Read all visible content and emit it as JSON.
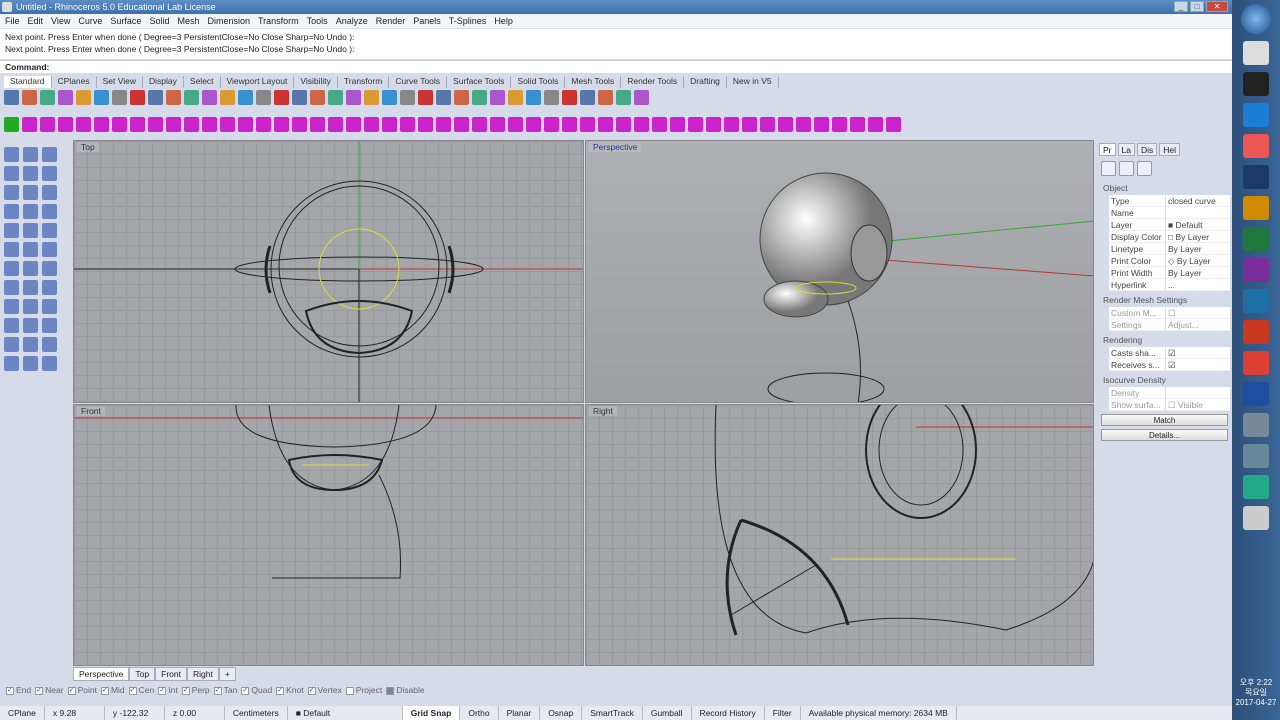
{
  "window": {
    "title": "Untitled - Rhinoceros 5.0 Educational Lab License"
  },
  "menu": [
    "File",
    "Edit",
    "View",
    "Curve",
    "Surface",
    "Solid",
    "Mesh",
    "Dimension",
    "Transform",
    "Tools",
    "Analyze",
    "Render",
    "Panels",
    "T-Splines",
    "Help"
  ],
  "command": {
    "history": [
      "Next point. Press Enter when done ( Degree=3  PersistentClose=No  Close  Sharp=No  Undo ):",
      "Next point. Press Enter when done ( Degree=3  PersistentClose=No  Close  Sharp=No  Undo ):"
    ],
    "prompt": "Command:"
  },
  "toolbar_tabs": [
    "Standard",
    "CPlanes",
    "Set View",
    "Display",
    "Select",
    "Viewport Layout",
    "Visibility",
    "Transform",
    "Curve Tools",
    "Surface Tools",
    "Solid Tools",
    "Mesh Tools",
    "Render Tools",
    "Drafting",
    "New in V5"
  ],
  "viewports": {
    "top": "Top",
    "perspective": "Perspective",
    "front": "Front",
    "right": "Right"
  },
  "viewport_tabs": [
    "Perspective",
    "Top",
    "Front",
    "Right",
    "+"
  ],
  "osnap": [
    {
      "label": "End",
      "checked": true
    },
    {
      "label": "Near",
      "checked": true
    },
    {
      "label": "Point",
      "checked": true
    },
    {
      "label": "Mid",
      "checked": true
    },
    {
      "label": "Cen",
      "checked": true
    },
    {
      "label": "Int",
      "checked": true
    },
    {
      "label": "Perp",
      "checked": true
    },
    {
      "label": "Tan",
      "checked": true
    },
    {
      "label": "Quad",
      "checked": true
    },
    {
      "label": "Knot",
      "checked": true
    },
    {
      "label": "Vertex",
      "checked": true
    },
    {
      "label": "Project",
      "checked": false
    },
    {
      "label": "Disable",
      "checked": false
    }
  ],
  "status": {
    "cplane": "CPlane",
    "x": "x 9.28",
    "y": "y -122.32",
    "z": "z 0.00",
    "units": "Centimeters",
    "layer": "Default",
    "grid_snap": "Grid Snap",
    "ortho": "Ortho",
    "planar": "Planar",
    "osnap": "Osnap",
    "smarttrack": "SmartTrack",
    "gumball": "Gumball",
    "record_history": "Record History",
    "filter": "Filter",
    "memory": "Available physical memory: 2634 MB"
  },
  "panel": {
    "tabs": [
      "Pr",
      "La",
      "Dis",
      "Hel"
    ],
    "object_header": "Object",
    "object": [
      {
        "k": "Type",
        "v": "closed curve"
      },
      {
        "k": "Name",
        "v": ""
      },
      {
        "k": "Layer",
        "v": "■ Default"
      },
      {
        "k": "Display Color",
        "v": "□ By Layer"
      },
      {
        "k": "Linetype",
        "v": "By Layer"
      },
      {
        "k": "Print Color",
        "v": "◇ By Layer"
      },
      {
        "k": "Print Width",
        "v": "By Layer"
      },
      {
        "k": "Hyperlink",
        "v": "..."
      }
    ],
    "render_mesh_header": "Render Mesh Settings",
    "render_mesh": [
      {
        "k": "Custom M...",
        "v": "☐"
      },
      {
        "k": "Settings",
        "v": "Adjust..."
      }
    ],
    "rendering_header": "Rendering",
    "rendering": [
      {
        "k": "Casts sha...",
        "v": "☑"
      },
      {
        "k": "Receives s...",
        "v": "☑"
      }
    ],
    "isocurve_header": "Isocurve Density",
    "isocurve": [
      {
        "k": "Density",
        "v": ""
      },
      {
        "k": "Show surfa...",
        "v": "☐ Visible"
      }
    ],
    "match": "Match",
    "details": "Details..."
  },
  "clock": {
    "time": "오후 2:22",
    "day": "목요일",
    "date": "2017-04-27"
  }
}
